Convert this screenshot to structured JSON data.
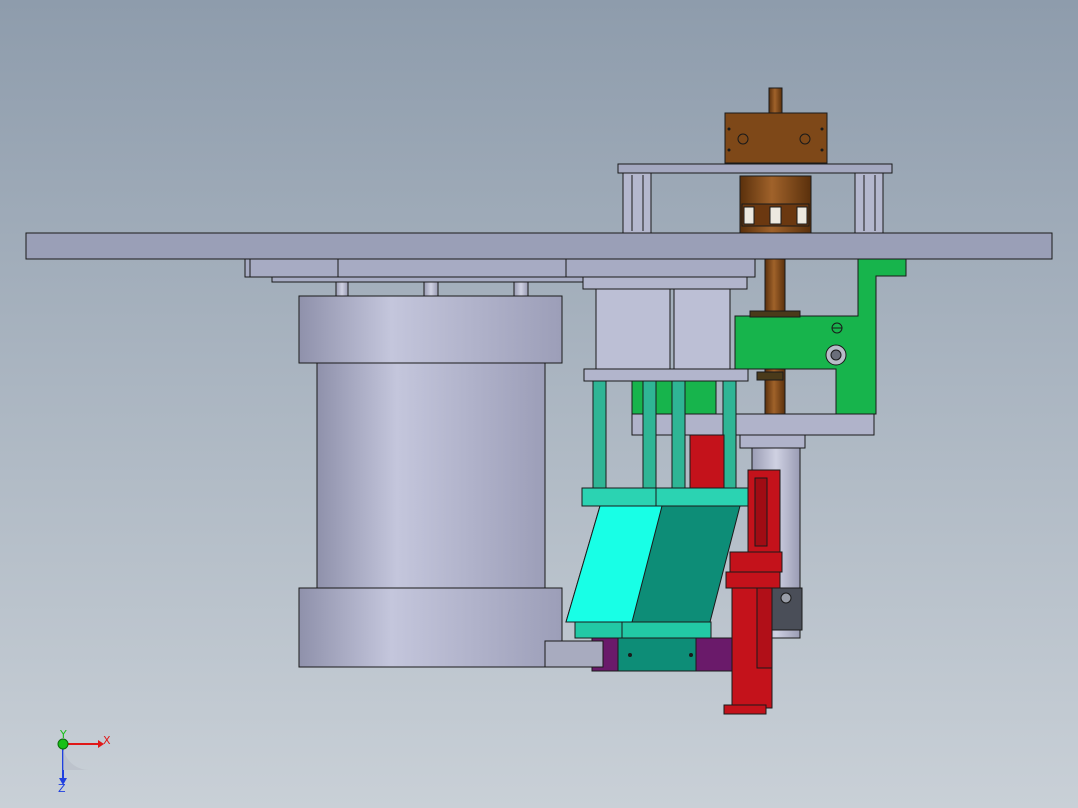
{
  "viewport": {
    "background_top": "#8e9cac",
    "background_bottom": "#c9d0d7"
  },
  "colors": {
    "plate_gray": "#9aa0ba",
    "cylinder_gray": "#b6b8cf",
    "motor_brown": "#7a4514",
    "bracket_green": "#15b34a",
    "rod_teal": "#2fb595",
    "wedge_cyan": "#16ffe8",
    "wedge_teal": "#0b8a74",
    "slide_red": "#c8101a",
    "base_purple": "#6a1a6a",
    "axis_x": "#e01818",
    "axis_y": "#18c018",
    "axis_z": "#2040e0"
  },
  "triad": {
    "x_label": "X",
    "y_label": "Y",
    "z_label": "Z"
  }
}
